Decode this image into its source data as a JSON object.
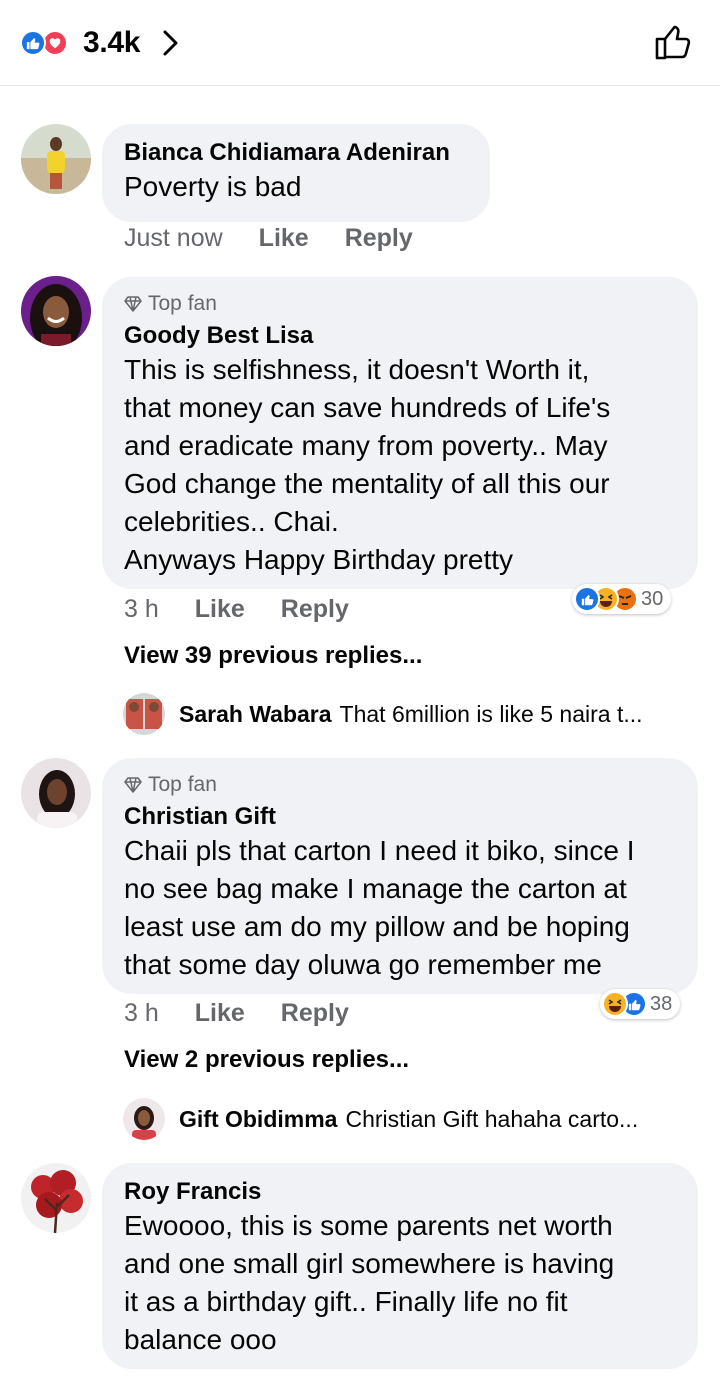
{
  "header": {
    "reaction_count": "3.4k",
    "reactions": [
      "like",
      "love"
    ]
  },
  "colors": {
    "like": "#1b74e4",
    "love": "#f33e58",
    "haha": "#f7b125",
    "angry": "#e9710f",
    "muted": "#65676b",
    "bubble": "#f0f2f5"
  },
  "comments": [
    {
      "author": "Bianca Chidiamara Adeniran",
      "badge": "",
      "text": "Poverty is bad",
      "time": "Just now",
      "like_label": "Like",
      "reply_label": "Reply"
    },
    {
      "author": "Goody Best Lisa",
      "badge": "Top fan",
      "text": "This is selfishness, it doesn't Worth it,\nthat money can save hundreds of Life's\nand eradicate many from poverty.. May\nGod change the mentality of all this our\ncelebrities.. Chai.\nAnyways Happy Birthday pretty",
      "time": "3 h",
      "like_label": "Like",
      "reply_label": "Reply",
      "reactions": [
        "like",
        "haha",
        "angry"
      ],
      "reaction_count": "30",
      "view_more": "View 39 previous replies...",
      "latest_reply": {
        "author": "Sarah Wabara",
        "text": "That 6million is like 5 naira t..."
      }
    },
    {
      "author": "Christian Gift",
      "badge": "Top fan",
      "text": "Chaii pls that carton I need it biko, since I\nno see bag make I manage the carton at\nleast use am do my pillow and be hoping\nthat some day oluwa go remember me",
      "time": "3 h",
      "like_label": "Like",
      "reply_label": "Reply",
      "reactions": [
        "haha",
        "like"
      ],
      "reaction_count": "38",
      "view_more": "View 2 previous replies...",
      "latest_reply": {
        "author": "Gift Obidimma",
        "text": "Christian Gift hahaha carto..."
      }
    },
    {
      "author": "Roy Francis",
      "badge": "",
      "text": "Ewoooo, this is some parents net worth\nand one small girl somewhere is having\nit as a birthday gift.. Finally life no fit\nbalance ooo"
    }
  ]
}
